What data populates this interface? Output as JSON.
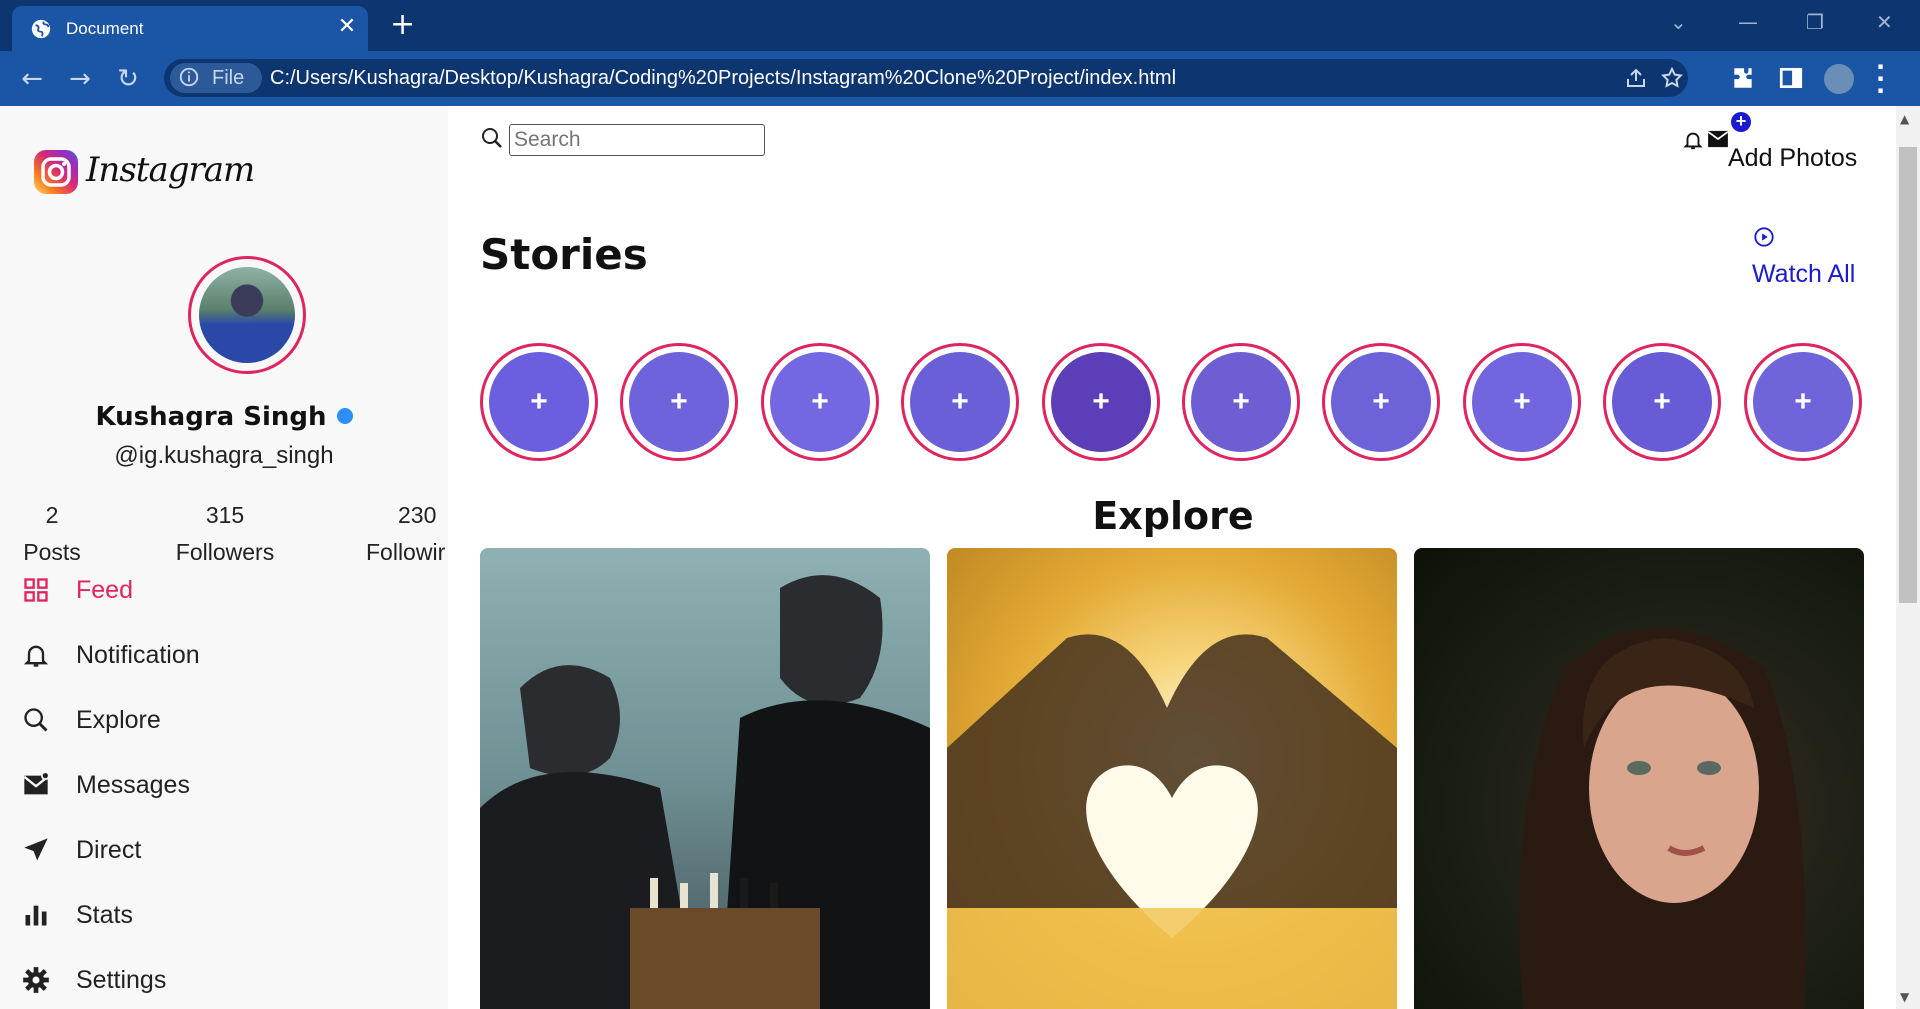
{
  "browser": {
    "tab_title": "Document",
    "file_label": "File",
    "url": "C:/Users/Kushagra/Desktop/Kushagra/Coding%20Projects/Instagram%20Clone%20Project/index.html"
  },
  "brand": {
    "logo_text": "Instagram"
  },
  "profile": {
    "name": "Kushagra Singh",
    "handle": "@ig.kushagra_singh",
    "stats": [
      {
        "value": "2",
        "label": "Posts"
      },
      {
        "value": "315",
        "label": "Followers"
      },
      {
        "value": "230",
        "label": "Followir"
      }
    ]
  },
  "menu": {
    "items": [
      {
        "label": "Feed",
        "icon": "grid-icon",
        "active": true
      },
      {
        "label": "Notification",
        "icon": "bell-icon"
      },
      {
        "label": "Explore",
        "icon": "search-icon"
      },
      {
        "label": "Messages",
        "icon": "mail-icon"
      },
      {
        "label": "Direct",
        "icon": "send-icon"
      },
      {
        "label": "Stats",
        "icon": "bar-chart-icon"
      },
      {
        "label": "Settings",
        "icon": "gear-icon"
      }
    ]
  },
  "header": {
    "search_placeholder": "Search",
    "add_photos_label": "Add Photos",
    "add_badge": "+"
  },
  "stories": {
    "title": "Stories",
    "watch_all_label": "Watch All",
    "plus_symbol": "+",
    "count": 10
  },
  "explore": {
    "title": "Explore"
  },
  "colors": {
    "accent": "#e0245e",
    "link_blue": "#1a1ad0",
    "browser_frame": "#0d3570",
    "browser_toolbar": "#1a55a6",
    "story_overlay": "#6f63dc"
  }
}
